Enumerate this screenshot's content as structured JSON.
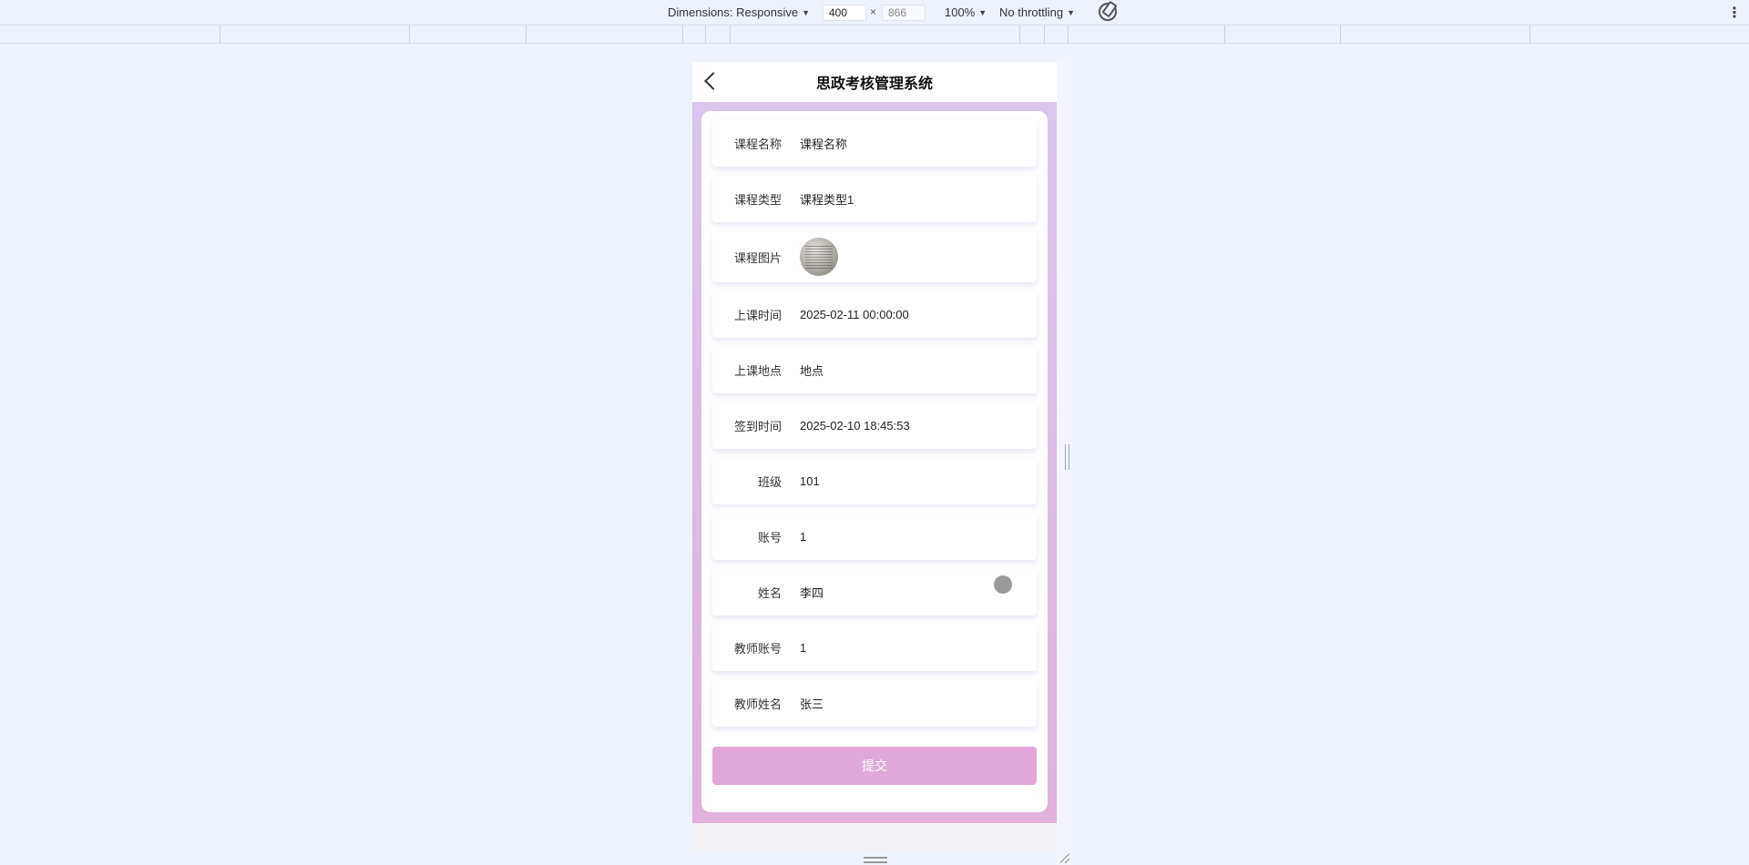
{
  "devtools": {
    "dimensions_label": "Dimensions: Responsive",
    "width": "400",
    "height_placeholder": "866",
    "times": "×",
    "zoom": "100%",
    "throttling": "No throttling",
    "more": "⋮"
  },
  "app": {
    "title": "思政考核管理系统"
  },
  "form": {
    "fields": [
      {
        "label": "课程名称",
        "value": "课程名称"
      },
      {
        "label": "课程类型",
        "value": "课程类型1"
      },
      {
        "label": "课程图片",
        "value": ""
      },
      {
        "label": "上课时间",
        "value": "2025-02-11 00:00:00"
      },
      {
        "label": "上课地点",
        "value": "地点"
      },
      {
        "label": "签到时间",
        "value": "2025-02-10 18:45:53"
      },
      {
        "label": "班级",
        "value": "101"
      },
      {
        "label": "账号",
        "value": "1"
      },
      {
        "label": "姓名",
        "value": "李四"
      },
      {
        "label": "教师账号",
        "value": "1"
      },
      {
        "label": "教师姓名",
        "value": "张三"
      }
    ],
    "submit_label": "提交"
  },
  "colors": {
    "gradient_top": "#d8c6ee",
    "gradient_bottom": "#e0b2dc",
    "submit_bg": "#e0a8d8"
  }
}
